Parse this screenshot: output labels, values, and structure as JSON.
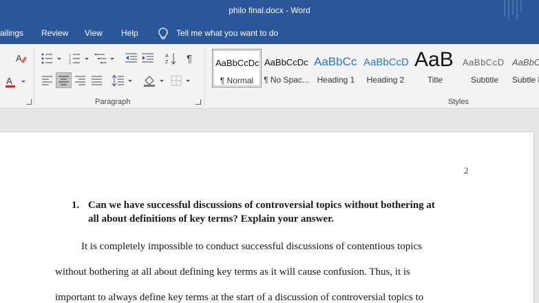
{
  "window": {
    "title": "philo final.docx - Word"
  },
  "menu": {
    "items": [
      "ailings",
      "Review",
      "View",
      "Help"
    ],
    "tell_me": "Tell me what you want to do"
  },
  "ribbon": {
    "paragraph_label": "Paragraph",
    "styles_label": "Styles",
    "styles": [
      {
        "sample": "AaBbCcDc",
        "name": "¶ Normal",
        "selected": true
      },
      {
        "sample": "AaBbCcDc",
        "name": "¶ No Spac..."
      },
      {
        "sample": "AaBbCc",
        "name": "Heading 1"
      },
      {
        "sample": "AaBbCcD",
        "name": "Heading 2"
      },
      {
        "sample": "AaB",
        "name": "Title"
      },
      {
        "sample": "AaBbCcD",
        "name": "Subtitle"
      },
      {
        "sample": "AaBbC",
        "name": "Subtle E"
      }
    ]
  },
  "document": {
    "page_number": "2",
    "question_number": "1.",
    "question_line1": "Can we have successful discussions of controversial topics without bothering at",
    "question_line2": "all about definitions of key terms? Explain your answer.",
    "body_line1": "It is completely impossible to conduct successful discussions of contentious topics",
    "body_line2": "without bothering at all about defining key terms as it will cause confusion. Thus, it is",
    "body_line3": "important to always define key terms at the start of a discussion of controversial topics to"
  },
  "colors": {
    "titlebar": "#2b579a",
    "ribbon": "#f3f3f3",
    "heading_blue": "#2e74b5"
  }
}
